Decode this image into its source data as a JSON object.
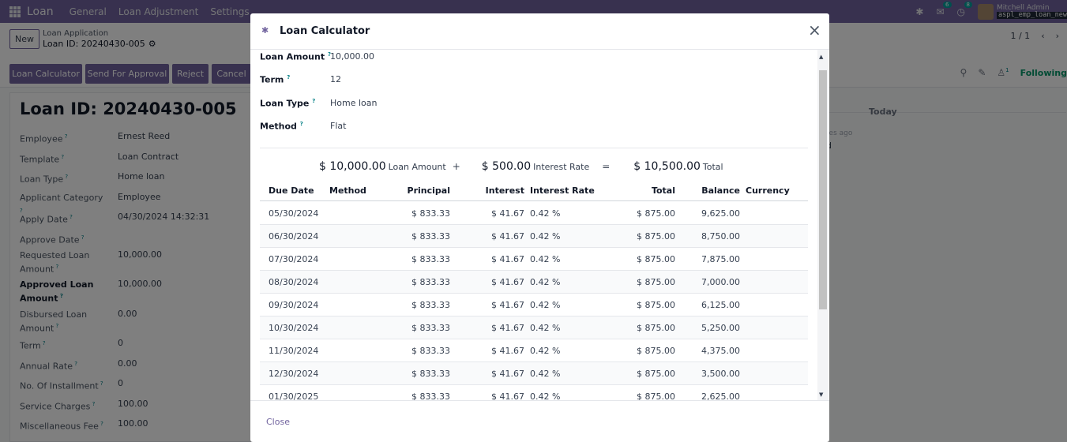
{
  "navbar": {
    "brand": "Loan",
    "menu": [
      "General",
      "Loan Adjustment",
      "Settings"
    ],
    "chat_badge": "6",
    "activity_badge": "8",
    "user_name": "Mitchell Admin",
    "db_name": "aspl_emp_loan_new"
  },
  "control": {
    "new_label": "New",
    "breadcrumb_parent": "Loan Application",
    "breadcrumb_current": "Loan ID: 20240430-005",
    "pager": "1 / 1",
    "actions": [
      "Loan Calculator",
      "Send For Approval",
      "Reject",
      "Cancel"
    ],
    "following": "Following",
    "attachment_count": "1"
  },
  "form": {
    "title": "Loan ID: 20240430-005",
    "fields": [
      {
        "label": "Employee",
        "value": "Ernest Reed"
      },
      {
        "label": "Template",
        "value": "Loan Contract"
      },
      {
        "label": "Loan Type",
        "value": "Home loan"
      },
      {
        "label": "Applicant Category",
        "value": "Employee"
      },
      {
        "label": "Apply Date",
        "value": "04/30/2024 14:32:31"
      },
      {
        "label": "Approve Date",
        "value": ""
      },
      {
        "label": "Requested Loan Amount",
        "value": "10,000.00"
      },
      {
        "label": "Approved Loan Amount",
        "value": "10,000.00"
      },
      {
        "label": "Disbursed Loan Amount",
        "value": "0.00"
      },
      {
        "label": "Term",
        "value": "0"
      },
      {
        "label": "Annual Rate",
        "value": "0.00"
      },
      {
        "label": "No. Of Installment",
        "value": "0"
      },
      {
        "label": "Service Charges",
        "value": "100.00"
      },
      {
        "label": "Miscellaneous Fee",
        "value": "100.00"
      }
    ]
  },
  "chatter": {
    "today": "Today",
    "time_ago": "tes ago",
    "msg": "d"
  },
  "modal": {
    "title": "Loan Calculator",
    "close_label": "Close",
    "fields": [
      {
        "label": "Loan Amount",
        "value": "10,000.00"
      },
      {
        "label": "Term",
        "value": "12"
      },
      {
        "label": "Loan Type",
        "value": "Home loan"
      },
      {
        "label": "Method",
        "value": "Flat"
      }
    ],
    "summary": {
      "loan_amount": "$ 10,000.00",
      "loan_amount_caption": "Loan Amount",
      "plus": "+",
      "interest": "$ 500.00",
      "interest_caption": "Interest Rate",
      "equals": "=",
      "total": "$ 10,500.00",
      "total_caption": "Total"
    },
    "columns": [
      "Due Date",
      "Method",
      "Principal",
      "Interest",
      "Interest Rate",
      "Total",
      "Balance",
      "Currency"
    ],
    "rows": [
      {
        "due": "05/30/2024",
        "method": "",
        "principal": "$ 833.33",
        "interest": "$ 41.67",
        "rate": "0.42 %",
        "total": "$ 875.00",
        "balance": "9,625.00",
        "currency": ""
      },
      {
        "due": "06/30/2024",
        "method": "",
        "principal": "$ 833.33",
        "interest": "$ 41.67",
        "rate": "0.42 %",
        "total": "$ 875.00",
        "balance": "8,750.00",
        "currency": ""
      },
      {
        "due": "07/30/2024",
        "method": "",
        "principal": "$ 833.33",
        "interest": "$ 41.67",
        "rate": "0.42 %",
        "total": "$ 875.00",
        "balance": "7,875.00",
        "currency": ""
      },
      {
        "due": "08/30/2024",
        "method": "",
        "principal": "$ 833.33",
        "interest": "$ 41.67",
        "rate": "0.42 %",
        "total": "$ 875.00",
        "balance": "7,000.00",
        "currency": ""
      },
      {
        "due": "09/30/2024",
        "method": "",
        "principal": "$ 833.33",
        "interest": "$ 41.67",
        "rate": "0.42 %",
        "total": "$ 875.00",
        "balance": "6,125.00",
        "currency": ""
      },
      {
        "due": "10/30/2024",
        "method": "",
        "principal": "$ 833.33",
        "interest": "$ 41.67",
        "rate": "0.42 %",
        "total": "$ 875.00",
        "balance": "5,250.00",
        "currency": ""
      },
      {
        "due": "11/30/2024",
        "method": "",
        "principal": "$ 833.33",
        "interest": "$ 41.67",
        "rate": "0.42 %",
        "total": "$ 875.00",
        "balance": "4,375.00",
        "currency": ""
      },
      {
        "due": "12/30/2024",
        "method": "",
        "principal": "$ 833.33",
        "interest": "$ 41.67",
        "rate": "0.42 %",
        "total": "$ 875.00",
        "balance": "3,500.00",
        "currency": ""
      },
      {
        "due": "01/30/2025",
        "method": "",
        "principal": "$ 833.33",
        "interest": "$ 41.67",
        "rate": "0.42 %",
        "total": "$ 875.00",
        "balance": "2,625.00",
        "currency": ""
      }
    ]
  }
}
